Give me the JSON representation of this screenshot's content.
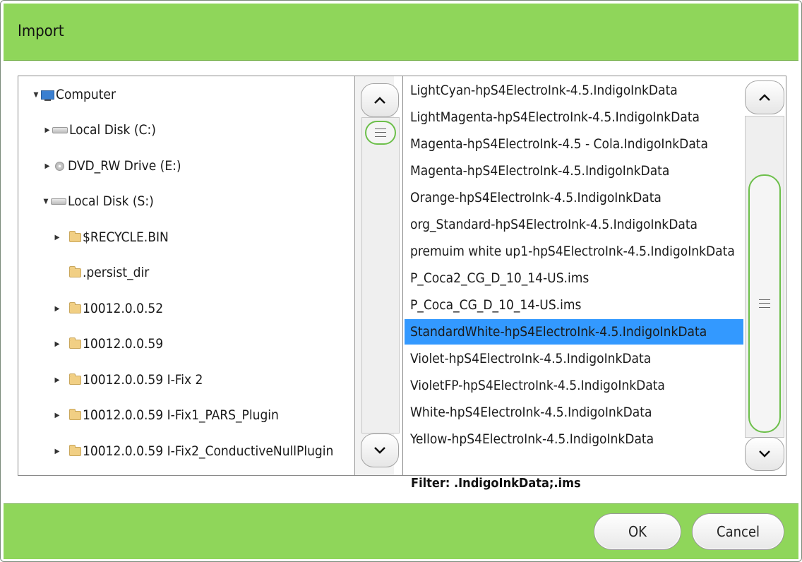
{
  "dialog": {
    "title": "Import",
    "filter_label": "Filter: .IndigoInkData;.ims",
    "ok_label": "OK",
    "cancel_label": "Cancel",
    "accent_color": "#8fd65a",
    "selection_color": "#3399ff"
  },
  "tree": {
    "items": [
      {
        "label": "Computer",
        "icon": "computer-icon",
        "expanded": true
      },
      {
        "label": "Local Disk (C:)",
        "icon": "hard-disk-icon",
        "expanded": false
      },
      {
        "label": "DVD_RW Drive (E:)",
        "icon": "dvd-drive-icon",
        "expanded": false
      },
      {
        "label": "Local Disk (S:)",
        "icon": "hard-disk-icon",
        "expanded": true
      },
      {
        "label": "$RECYCLE.BIN",
        "icon": "folder-icon",
        "expanded": false
      },
      {
        "label": ".persist_dir",
        "icon": "folder-icon",
        "expanded": null
      },
      {
        "label": "10012.0.0.52",
        "icon": "folder-icon",
        "expanded": false
      },
      {
        "label": "10012.0.0.59",
        "icon": "folder-icon",
        "expanded": false
      },
      {
        "label": "10012.0.0.59 I-Fix 2",
        "icon": "folder-icon",
        "expanded": false
      },
      {
        "label": "10012.0.0.59 I-Fix1_PARS_Plugin",
        "icon": "folder-icon",
        "expanded": false
      },
      {
        "label": "10012.0.0.59 I-Fix2_ConductiveNullPlugin",
        "icon": "folder-icon",
        "expanded": false
      }
    ]
  },
  "files": {
    "items": [
      {
        "label": "LightCyan-hpS4ElectroInk-4.5.IndigoInkData",
        "selected": false
      },
      {
        "label": "LightMagenta-hpS4ElectroInk-4.5.IndigoInkData",
        "selected": false
      },
      {
        "label": "Magenta-hpS4ElectroInk-4.5 - Cola.IndigoInkData",
        "selected": false
      },
      {
        "label": "Magenta-hpS4ElectroInk-4.5.IndigoInkData",
        "selected": false
      },
      {
        "label": "Orange-hpS4ElectroInk-4.5.IndigoInkData",
        "selected": false
      },
      {
        "label": "org_Standard-hpS4ElectroInk-4.5.IndigoInkData",
        "selected": false
      },
      {
        "label": "premuim white up1-hpS4ElectroInk-4.5.IndigoInkData",
        "selected": false
      },
      {
        "label": "P_Coca2_CG_D_10_14-US.ims",
        "selected": false
      },
      {
        "label": "P_Coca_CG_D_10_14-US.ims",
        "selected": false
      },
      {
        "label": "StandardWhite-hpS4ElectroInk-4.5.IndigoInkData",
        "selected": true
      },
      {
        "label": "Violet-hpS4ElectroInk-4.5.IndigoInkData",
        "selected": false
      },
      {
        "label": "VioletFP-hpS4ElectroInk-4.5.IndigoInkData",
        "selected": false
      },
      {
        "label": "White-hpS4ElectroInk-4.5.IndigoInkData",
        "selected": false
      },
      {
        "label": "Yellow-hpS4ElectroInk-4.5.IndigoInkData",
        "selected": false
      }
    ]
  }
}
